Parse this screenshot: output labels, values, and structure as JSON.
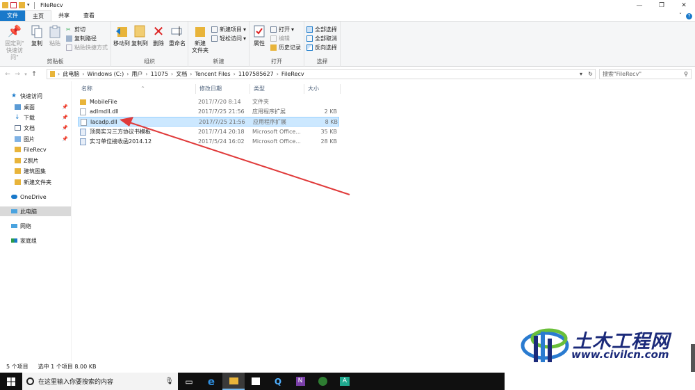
{
  "window": {
    "title": "FileRecv",
    "controls": [
      "—",
      "❐",
      "✕"
    ]
  },
  "ribbon_tabs": [
    "文件",
    "主页",
    "共享",
    "查看"
  ],
  "ribbon": {
    "clipboard": {
      "pin_line1": "固定到\"",
      "pin_line2": "快速访问\"",
      "copy": "复制",
      "paste": "粘贴",
      "cut": "剪切",
      "copy_path": "复制路径",
      "paste_shortcut": "粘贴快捷方式",
      "label": "剪贴板"
    },
    "organize": {
      "move_to": "移动到",
      "copy_to": "复制到",
      "delete": "删除",
      "rename": "重命名",
      "label": "组织"
    },
    "new": {
      "new_folder_line1": "新建",
      "new_folder_line2": "文件夹",
      "new_item": "新建项目",
      "easy_access": "轻松访问",
      "label": "新建"
    },
    "open": {
      "properties": "属性",
      "open": "打开",
      "edit": "编辑",
      "history": "历史记录",
      "label": "打开"
    },
    "select": {
      "select_all": "全部选择",
      "select_none": "全部取消",
      "invert": "反向选择",
      "label": "选择"
    }
  },
  "address": {
    "crumbs": [
      "此电脑",
      "Windows (C:)",
      "用户",
      "11075",
      "文档",
      "Tencent Files",
      "1107585627",
      "FileRecv"
    ],
    "search_placeholder": "搜索\"FileRecv\""
  },
  "nav_pane": [
    {
      "label": "快速访问",
      "icon": "star-icon",
      "indent": 0,
      "pinned": false
    },
    {
      "label": "桌面",
      "icon": "folder-icon",
      "indent": 1,
      "pinned": true
    },
    {
      "label": "下载",
      "icon": "download-icon",
      "indent": 1,
      "pinned": true
    },
    {
      "label": "文档",
      "icon": "document-icon",
      "indent": 1,
      "pinned": true
    },
    {
      "label": "图片",
      "icon": "picture-icon",
      "indent": 1,
      "pinned": true
    },
    {
      "label": "FileRecv",
      "icon": "folder-icon",
      "indent": 1,
      "pinned": false
    },
    {
      "label": "Z照片",
      "icon": "folder-icon",
      "indent": 1,
      "pinned": false
    },
    {
      "label": "建筑图集",
      "icon": "folder-icon",
      "indent": 1,
      "pinned": false
    },
    {
      "label": "新建文件夹",
      "icon": "folder-icon",
      "indent": 1,
      "pinned": false
    },
    {
      "label": "OneDrive",
      "icon": "cloud-icon",
      "indent": 0,
      "pinned": false
    },
    {
      "label": "此电脑",
      "icon": "computer-icon",
      "indent": 0,
      "pinned": false,
      "selected": true
    },
    {
      "label": "网络",
      "icon": "network-icon",
      "indent": 0,
      "pinned": false
    },
    {
      "label": "家庭组",
      "icon": "homegroup-icon",
      "indent": 0,
      "pinned": false
    }
  ],
  "columns": [
    "名称",
    "修改日期",
    "类型",
    "大小"
  ],
  "files": [
    {
      "name": "MobileFile",
      "date": "2017/7/20 8:14",
      "type": "文件夹",
      "size": "",
      "icon": "folder"
    },
    {
      "name": "adlmdll.dll",
      "date": "2017/7/25 21:56",
      "type": "应用程序扩展",
      "size": "2 KB",
      "icon": "dll"
    },
    {
      "name": "lacadp.dll",
      "date": "2017/7/25 21:56",
      "type": "应用程序扩展",
      "size": "8 KB",
      "icon": "dll",
      "selected": true
    },
    {
      "name": "顶岗实习三方协议书模板",
      "date": "2017/7/14 20:18",
      "type": "Microsoft Office...",
      "size": "35 KB",
      "icon": "doc"
    },
    {
      "name": "实习单位接收函2014.12",
      "date": "2017/5/24 16:02",
      "type": "Microsoft Office...",
      "size": "28 KB",
      "icon": "doc"
    }
  ],
  "status": {
    "count": "5 个项目",
    "selection": "选中 1 个项目  8.00 KB"
  },
  "taskbar": {
    "search_text": "在这里输入你要搜索的内容"
  },
  "watermark": {
    "title": "土木工程网",
    "url": "www.civilcn.com"
  },
  "colors": {
    "accent": "#1979ca",
    "selection": "#cce8ff",
    "arrow": "#e03a3a",
    "folder": "#e8b43a"
  }
}
